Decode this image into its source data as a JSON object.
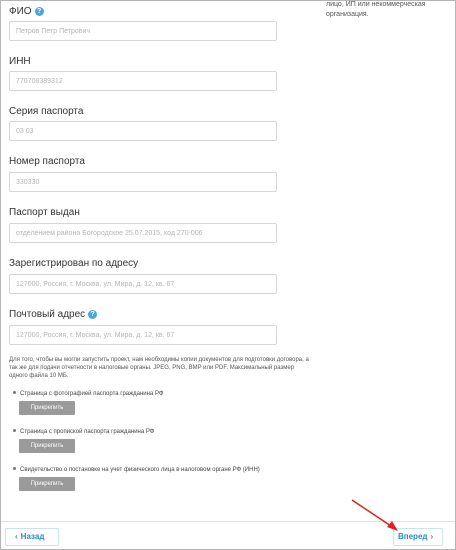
{
  "side_note": "лицо, ИП или некоммерческая организация.",
  "help_icon_glyph": "?",
  "fields": [
    {
      "label": "ФИО",
      "value": "",
      "placeholder": "Петров Петр Петрович",
      "has_help": true
    },
    {
      "label": "ИНН",
      "value": "",
      "placeholder": "770708389312",
      "has_help": false
    },
    {
      "label": "Серия паспорта",
      "value": "",
      "placeholder": "03 03",
      "has_help": false
    },
    {
      "label": "Номер паспорта",
      "value": "",
      "placeholder": "330330",
      "has_help": false
    },
    {
      "label": "Паспорт выдан",
      "value": "",
      "placeholder": "отделением района Богородское 25.07.2015, код 270-006",
      "has_help": false
    },
    {
      "label": "Зарегистрирован по адресу",
      "value": "",
      "placeholder": "127000, Россия, г. Москва, ул. Мира, д. 12, кв. 67",
      "has_help": false
    },
    {
      "label": "Почтовый адрес",
      "value": "",
      "placeholder": "127000, Россия, г. Москва, ул. Мира, д. 12, кв. 67",
      "has_help": true
    }
  ],
  "info_text": "Для того, чтобы вы могли запустить проект, нам необходимы копии документов для подготовки договора, а так же для подачи отчетности в налоговые органы. JPEG, PNG, BMP или PDF. Максимальный размер одного файла 10 МБ.",
  "documents": [
    {
      "label": "Страница с фотографией паспорта гражданина РФ",
      "button": "Прикрепить"
    },
    {
      "label": "Страница с пропиской паспорта гражданина РФ",
      "button": "Прикрепить"
    },
    {
      "label": "Свидетельство о постановке на учет физического лица в налоговом органе РФ (ИНН)",
      "button": "Прикрепить"
    }
  ],
  "nav": {
    "back_label": "Назад",
    "next_label": "Вперед",
    "back_icon": "chevron-left-icon",
    "next_icon": "chevron-right-icon"
  },
  "colors": {
    "accent": "#2a8ac1",
    "help_icon": "#4aa8d8",
    "attach_button": "#9a9a9a",
    "annotation_arrow": "#e02020"
  }
}
